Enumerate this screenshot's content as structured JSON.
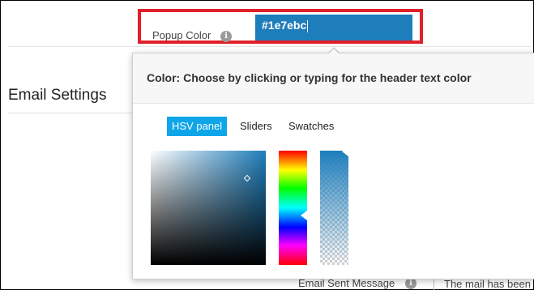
{
  "popup_color": {
    "label": "Popup Color",
    "value": "#1e7ebc",
    "info_icon": "i"
  },
  "section": {
    "title": "Email Settings"
  },
  "picker": {
    "title": "Color: Choose by clicking or typing for the header text color",
    "tabs": [
      {
        "label": "HSV panel",
        "active": true
      },
      {
        "label": "Sliders",
        "active": false
      },
      {
        "label": "Swatches",
        "active": false
      }
    ],
    "selected_color": "#1e7ebc"
  },
  "email_sent": {
    "label": "Email Sent Message",
    "info_icon": "i",
    "value": "The mail has been"
  },
  "colors": {
    "highlight": "#e0202a",
    "input_bg": "#1e7ebc",
    "active_tab": "#0ea5e9"
  }
}
